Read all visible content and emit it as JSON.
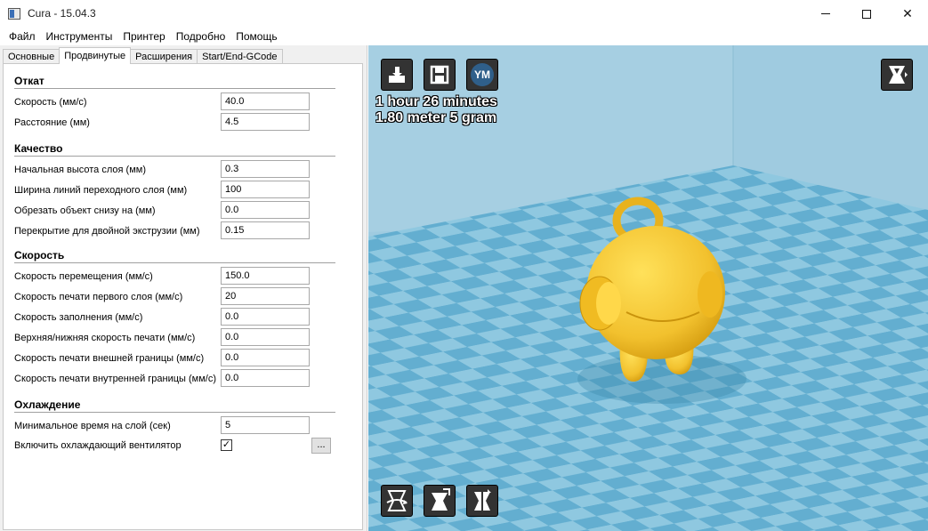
{
  "window": {
    "title": "Cura - 15.04.3"
  },
  "menu": [
    "Файл",
    "Инструменты",
    "Принтер",
    "Подробно",
    "Помощь"
  ],
  "tabs": [
    "Основные",
    "Продвинутые",
    "Расширения",
    "Start/End-GCode"
  ],
  "active_tab": "Продвинутые",
  "sections": {
    "retraction": {
      "title": "Откат",
      "speed_label": "Скорость (мм/с)",
      "speed_value": "40.0",
      "distance_label": "Расстояние (мм)",
      "distance_value": "4.5"
    },
    "quality": {
      "title": "Качество",
      "initial_layer_label": "Начальная высота слоя (мм)",
      "initial_layer_value": "0.3",
      "line_width_label": "Ширина линий переходного слоя (мм)",
      "line_width_value": "100",
      "cut_off_label": "Обрезать объект снизу на (мм)",
      "cut_off_value": "0.0",
      "overlap_label": "Перекрытие для двойной экструзии (мм)",
      "overlap_value": "0.15"
    },
    "speed": {
      "title": "Скорость",
      "travel_label": "Скорость перемещения (мм/с)",
      "travel_value": "150.0",
      "first_layer_label": "Скорость печати первого слоя (мм/с)",
      "first_layer_value": "20",
      "infill_label": "Скорость заполнения (мм/с)",
      "infill_value": "0.0",
      "topbottom_label": "Верхняя/нижняя скорость печати (мм/с)",
      "topbottom_value": "0.0",
      "outer_shell_label": "Скорость печати внешней границы (мм/с)",
      "outer_shell_value": "0.0",
      "inner_shell_label": "Скорость печати внутренней границы (мм/с)",
      "inner_shell_value": "0.0"
    },
    "cooling": {
      "title": "Охлаждение",
      "min_layer_time_label": "Минимальное время на слой (сек)",
      "min_layer_time_value": "5",
      "fan_label": "Включить охлаждающий вентилятор",
      "fan_checked": "✓",
      "more_button": "..."
    }
  },
  "viewport": {
    "print_time": "1 hour 26 minutes",
    "print_material": "1.80 meter 5 gram",
    "ym_label": "YM",
    "colors": {
      "sky": "#a6cfe2",
      "floor_light": "#8fc8e0",
      "floor_dark": "#63aed0",
      "model": "#f2c12e"
    }
  }
}
